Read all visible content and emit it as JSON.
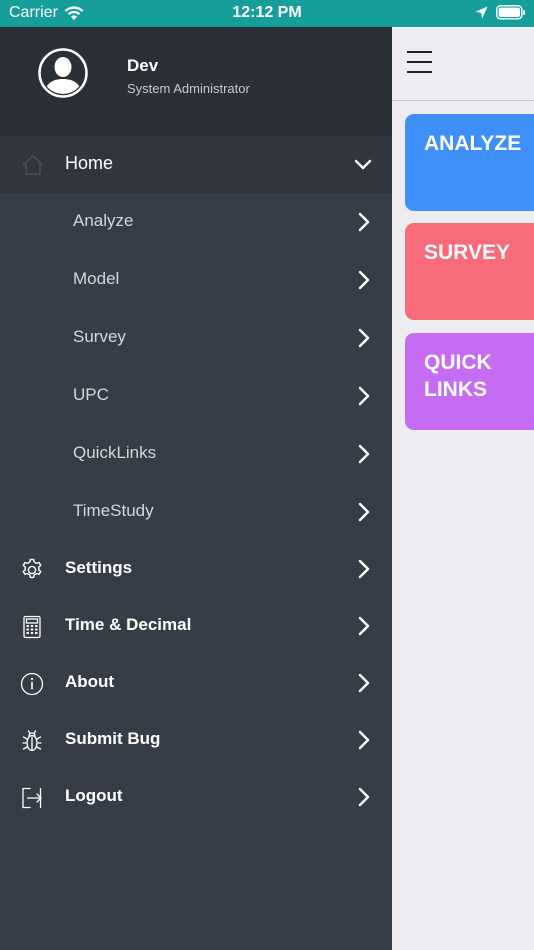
{
  "status_bar": {
    "carrier": "Carrier",
    "time": "12:12 PM"
  },
  "drawer": {
    "user": {
      "name": "Dev",
      "role": "System Administrator"
    },
    "home": {
      "label": "Home",
      "icon": "home-icon",
      "expanded": true
    },
    "submenu": [
      {
        "label": "Analyze"
      },
      {
        "label": "Model"
      },
      {
        "label": "Survey"
      },
      {
        "label": "UPC"
      },
      {
        "label": "QuickLinks"
      },
      {
        "label": "TimeStudy"
      }
    ],
    "items": [
      {
        "label": "Settings",
        "icon": "gear-icon"
      },
      {
        "label": "Time & Decimal",
        "icon": "calculator-icon"
      },
      {
        "label": "About",
        "icon": "info-icon"
      },
      {
        "label": "Submit Bug",
        "icon": "bug-icon"
      },
      {
        "label": "Logout",
        "icon": "logout-icon"
      }
    ]
  },
  "tiles": [
    {
      "label": "ANALYZE",
      "color": "#3e8ff7"
    },
    {
      "label": "SURVEY",
      "color": "#f86b7b"
    },
    {
      "label": "QUICK LINKS",
      "color": "#c46cf3"
    }
  ],
  "colors": {
    "status_bar": "#159e9a",
    "drawer": "#373d46",
    "drawer_header": "#2b3036"
  }
}
